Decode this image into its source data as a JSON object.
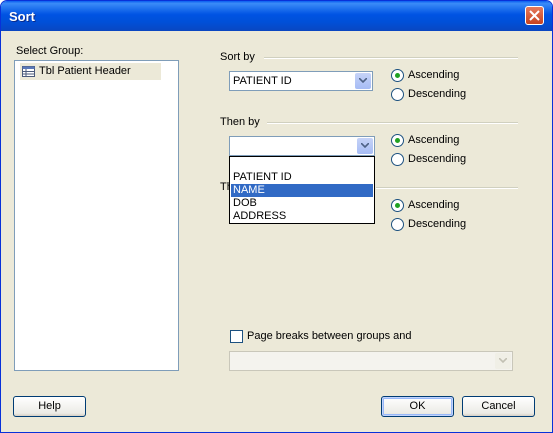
{
  "window": {
    "title": "Sort"
  },
  "left_panel": {
    "label": "Select Group:",
    "items": [
      {
        "label": "Tbl Patient Header",
        "icon": "table-icon"
      }
    ]
  },
  "sort_by": {
    "label": "Sort by",
    "value": "PATIENT ID",
    "ascending": "Ascending",
    "descending": "Descending",
    "selected": "Ascending"
  },
  "then_by_1": {
    "label": "Then by",
    "value": "",
    "ascending": "Ascending",
    "descending": "Descending",
    "selected": "Ascending",
    "dropdown_open": true,
    "options": [
      "PATIENT ID",
      "NAME",
      "DOB",
      "ADDRESS"
    ],
    "highlighted": "NAME"
  },
  "then_by_2": {
    "label": "Th",
    "ascending": "Ascending",
    "descending": "Descending",
    "selected": "Ascending"
  },
  "page_breaks": {
    "label": "Page breaks between groups and",
    "checked": false,
    "value": ""
  },
  "buttons": {
    "help": "Help",
    "ok": "OK",
    "cancel": "Cancel"
  },
  "colors": {
    "title_bar": "#0053e3",
    "dialog_bg": "#ece9d8",
    "selection": "#316ac5",
    "radio_dot": "#21a121"
  }
}
